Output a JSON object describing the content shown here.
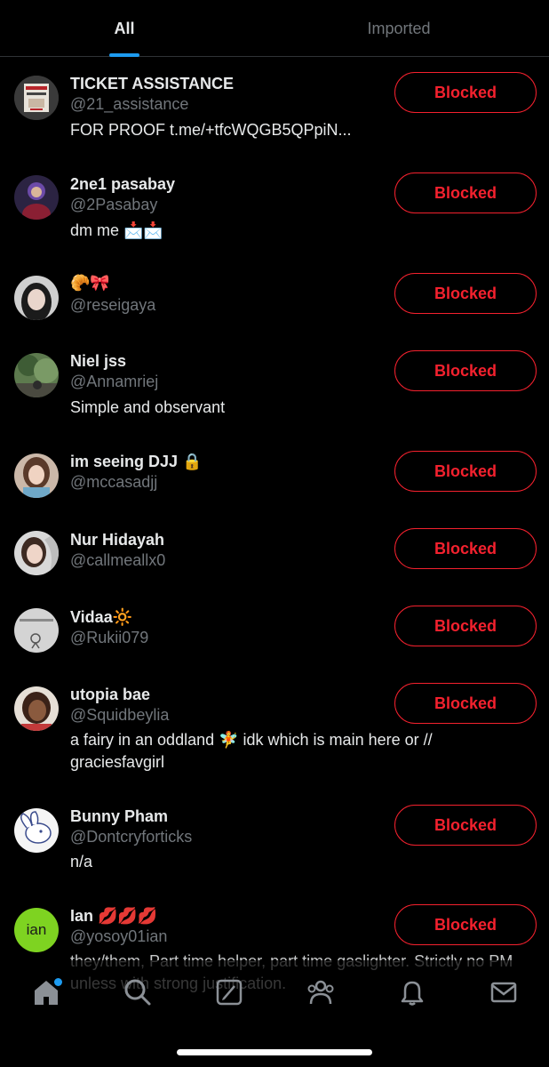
{
  "tabs": [
    {
      "label": "All",
      "active": true
    },
    {
      "label": "Imported",
      "active": false
    }
  ],
  "blocked_label": "Blocked",
  "users": [
    {
      "name": "TICKET ASSISTANCE",
      "handle": "@21_assistance",
      "bio": "FOR PROOF t.me/+tfcWQGB5QPpiN..."
    },
    {
      "name": "2ne1 pasabay",
      "handle": "@2Pasabay",
      "bio": "dm me 📩📩"
    },
    {
      "name": "🥐🎀",
      "handle": "@reseigaya",
      "bio": ""
    },
    {
      "name": "Niel jss",
      "handle": "@Annamriej",
      "bio": "Simple and observant"
    },
    {
      "name": "im seeing DJJ 🔒",
      "handle": "@mccasadjj",
      "bio": ""
    },
    {
      "name": "Nur Hidayah",
      "handle": "@callmeallx0",
      "bio": ""
    },
    {
      "name": "Vidaa🔆",
      "handle": "@Rukii079",
      "bio": ""
    },
    {
      "name": "utopia bae",
      "handle": "@Squidbeylia",
      "bio": "a fairy in an oddland 🧚 idk which is main here or // graciesfavgirl"
    },
    {
      "name": "Bunny Pham",
      "handle": "@Dontcryforticks",
      "bio": "n/a"
    },
    {
      "name": "Ian 💋💋💋",
      "handle": "@yosoy01ian",
      "bio": "they/them, Part time helper, part time gaslighter. Strictly no PM unless with strong justification."
    }
  ],
  "avatar_text_ian": "ian",
  "colors": {
    "accent": "#1d9bf0",
    "blocked": "#f4212e",
    "secondary_text": "#71767b",
    "ian_avatar": "#7ed321"
  },
  "bottom_nav": [
    "home-icon",
    "search-icon",
    "spaces-icon",
    "communities-icon",
    "notifications-icon",
    "messages-icon"
  ]
}
